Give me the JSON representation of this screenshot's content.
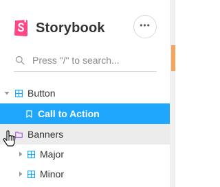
{
  "app": {
    "brand": "Storybook",
    "menu_label": "•••"
  },
  "search": {
    "placeholder": "Press \"/\" to search..."
  },
  "tree": {
    "button": {
      "label": "Button"
    },
    "call_to_action": {
      "label": "Call to Action"
    },
    "banners": {
      "label": "Banners"
    },
    "major": {
      "label": "Major"
    },
    "minor": {
      "label": "Minor"
    }
  },
  "colors": {
    "accent": "#1ea7fd",
    "logo": "#ff4785",
    "hover_row": "#ececec"
  },
  "icons": {
    "logo": "storybook-logo-icon",
    "menu": "ellipsis-icon",
    "search": "search-icon",
    "group": "component-icon",
    "story": "bookmark-icon",
    "folder": "folder-icon",
    "cursor": "hand-cursor-icon"
  }
}
